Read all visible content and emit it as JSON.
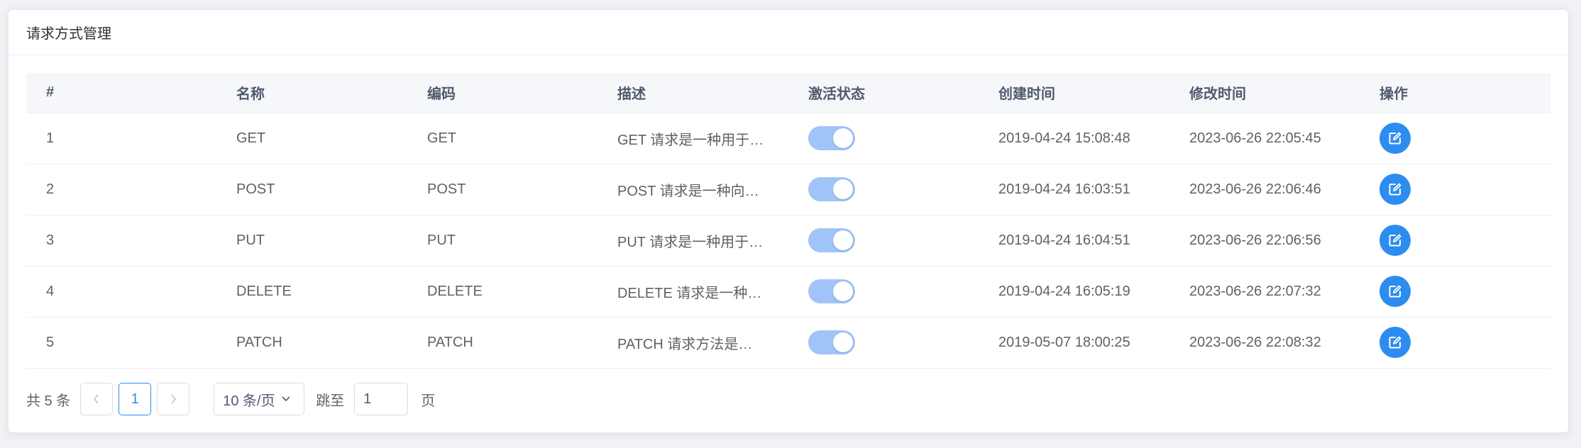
{
  "card": {
    "title": "请求方式管理"
  },
  "table": {
    "headers": [
      "#",
      "名称",
      "编码",
      "描述",
      "激活状态",
      "创建时间",
      "修改时间",
      "操作"
    ],
    "rows": [
      {
        "index": "1",
        "name": "GET",
        "code": "GET",
        "description": "GET 请求是一种用于…",
        "active": true,
        "created": "2019-04-24 15:08:48",
        "modified": "2023-06-26 22:05:45"
      },
      {
        "index": "2",
        "name": "POST",
        "code": "POST",
        "description": "POST 请求是一种向…",
        "active": true,
        "created": "2019-04-24 16:03:51",
        "modified": "2023-06-26 22:06:46"
      },
      {
        "index": "3",
        "name": "PUT",
        "code": "PUT",
        "description": "PUT 请求是一种用于…",
        "active": true,
        "created": "2019-04-24 16:04:51",
        "modified": "2023-06-26 22:06:56"
      },
      {
        "index": "4",
        "name": "DELETE",
        "code": "DELETE",
        "description": "DELETE 请求是一种…",
        "active": true,
        "created": "2019-04-24 16:05:19",
        "modified": "2023-06-26 22:07:32"
      },
      {
        "index": "5",
        "name": "PATCH",
        "code": "PATCH",
        "description": "PATCH 请求方法是…",
        "active": true,
        "created": "2019-05-07 18:00:25",
        "modified": "2023-06-26 22:08:32"
      }
    ]
  },
  "pagination": {
    "total_text": "共 5 条",
    "prev_icon": "chevron-left-icon",
    "next_icon": "chevron-right-icon",
    "current_page": "1",
    "page_size_label": "10 条/页",
    "jump_label": "跳至",
    "jump_value": "1",
    "page_suffix": "页"
  },
  "colors": {
    "accent": "#2d8cf0",
    "switch_on": "#a0c4f7",
    "header_bg": "#f5f7fa"
  }
}
